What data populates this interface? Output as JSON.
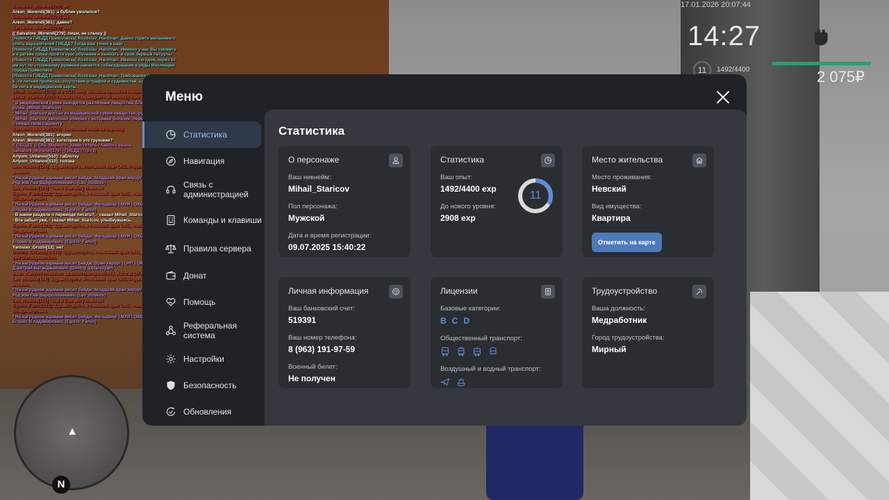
{
  "chat": [
    {
      "t": "Salvatore_Morendi[279]: м?",
      "c": "red"
    },
    {
      "t": "Areon_Morendi[381]: а бублик уволился?",
      "c": ""
    },
    {
      "t": "Salvatore_Morendi[279]: да",
      "c": "red"
    },
    {
      "t": "Areon_Morendi[381]: давно?",
      "c": ""
    },
    {
      "t": "Salvatore_Morendi[279]: нез",
      "c": "red"
    },
    {
      "t": "(( Salvatore_Morendi[279]: пиши, не слышу ))",
      "c": ""
    },
    {
      "t": "[Новости ГИБДД Приволжска] Rostislav_Hardman: Давно горите желанием п опять нарушителей ГИБДД? Тогда вам точно к нам!",
      "c": "cyan"
    },
    {
      "t": "[Новости ГИБДД Приволжска] Rostislav_Hardman: Именно у нас Вы сможете в к раткие сроки пройти курс обучения и выехать в свой первый патруль!",
      "c": "cyan"
    },
    {
      "t": "[Новости ГИБДД Приволжска] Rostislav_Hardman: Именно сегодня, через 10 ми нут по столичному времени начнется собеседование в ряды Инспекции города Приволжск.",
      "c": "cyan"
    },
    {
      "t": "[Новости ГИБДД Приволжска] Rostislav_Hardman: Требования к кандидатам: 5 -ти летняя прописка, отсутствие штрафов и судимостей, наличие военного би лета и медицинской карты.",
      "c": "cyan"
    },
    {
      "t": "Mihail_Staricov[370]: Я в ОСП хочу. Можешь провести лекции, которые нужн",
      "c": "red"
    },
    {
      "t": "Mihail_Staricov[370]: Пожалуйста, ожидайте. Я выпишу Вам заключение.",
      "c": "red"
    },
    {
      "t": "* В медицинской сумке находятся различные лекарства, бланки эпикризов и ручка. (Mihail_Staricov)",
      "c": "violet"
    },
    {
      "t": "* Mihail_Staricov достал из медицинской сумки лекарство, ручку и эпикриз",
      "c": "violet"
    },
    {
      "t": "* Mihail_Staricov заполнил эпикриз с историей болезни, передал его вместе с лекарством пациенту",
      "c": "violet"
    },
    {
      "t": "Salvatore_Morendi[279]: заявление пиши на перевод",
      "c": "red"
    },
    {
      "t": "Areon_Morendi[381]: егорио",
      "c": ""
    },
    {
      "t": "Areon_Morendi[381]: категории b это грузовик?",
      "c": ""
    },
    {
      "t": "(( ОБЩЕЕ )) ОКБ Мирного: Заместитель главного врача Salvatore_Morendi[279] - ГИБДД (Тгр.г3)",
      "c": "pink"
    },
    {
      "t": "Artyom_Urbanov[510]: таблотку",
      "c": ""
    },
    {
      "t": "Artyom_Urbanov[510]: голова",
      "c": ""
    },
    {
      "t": "Lev_Rodkov[124]: Здравствуйте, я печаный врач ОКБ, Родков Лев Варфоло меевич.",
      "c": "red"
    },
    {
      "t": "* На нагрудном кармане висит бейдж: Младший врач-хирург | АХО | ОКБ-М | Род ков Лев Варфоломеевич. (Lev_Rodkov)",
      "c": "violet"
    },
    {
      "t": "Lev_Rodkov[124]: Чем я Вам могу помочь?",
      "c": "red"
    },
    {
      "t": "Egorio_Famin[322]: Здравствуйте, я печаный врач ОКБ, Фамин Егорио Владими рович.",
      "c": "red"
    },
    {
      "t": "* На нагрудном кармане висит бейдж: Фельдшер | МУИ | ОКБ-М | Фамин Егорио В ладимирович. (Egorio_Famin)",
      "c": "violet"
    },
    {
      "t": "- В каком разделе о переводе писать?, - сказал Mihail_Staricov, улыбнувши",
      "c": ""
    },
    {
      "t": "- Все забыл уже, - сказал Mihail_Staricov, улыбнувшись.",
      "c": ""
    },
    {
      "t": "Egorio_Famin[322]: Здравствуйте, я печаный врач ОКБ, Фамин Егорио Владими рович.",
      "c": "red"
    },
    {
      "t": "* На нагрудном кармане висит бейдж: Фельдшер | МУИ | ОКБ-М | Фамин Егорио В ладимирович. (Egorio_Famin)",
      "c": "violet"
    },
    {
      "t": "Yaroslav_Gruzin[12]: нет",
      "c": ""
    },
    {
      "t": "Dmitriy_Delarozyan[43]: Здравствуйте, я печаный врач ОКБ, Деларозян Дмит рий Ватанджанович.",
      "c": "red"
    },
    {
      "t": "* На нагрудном кармане висит бейдж: Врач-хирург | ОНТ | ОКБ-М | Деларозян Д митрий Ватанджанович. (Dmitriy_Delarozyan)",
      "c": "violet"
    },
    {
      "t": "Sean_Kadyrov повысил администратора Mirella_Kutaraz (АГА 30+ до МК)",
      "c": "red"
    },
    {
      "t": "Lev_Rodkov[124]: Здравствуйте, я печаный врач ОКБ, Родков Лев Варфоло меевич.",
      "c": "red"
    },
    {
      "t": "* На нагрудном кармане висит бейдж: Младший врач-хирург | АХО | ОКБ-М | Род ков Лев Варфоломеевич. (Lev_Rodkov)",
      "c": "violet"
    },
    {
      "t": "Lev_Rodkov[124]: Чем я Вам могу помочь?",
      "c": "red"
    },
    {
      "t": "Egorio_Famin[322]: Здравствуйте, я печаный врач ОКБ, Фамин Егорио Владими рович.",
      "c": "red"
    },
    {
      "t": "* На нагрудном кармане висит бейдж: Фельдшер | МУИ | ОКБ-М | Фамин Егорио В ладимирович. (Egorio_Famin)",
      "c": "violet"
    }
  ],
  "hud": {
    "date": "17.01.2026 20:07:44",
    "time": "14:27",
    "level": "11",
    "exp": "1492/4400",
    "money": "2 075₽"
  },
  "menu": {
    "title": "Меню",
    "close_icon": "close-icon",
    "nav": [
      {
        "label": "Статистика",
        "icon": "pie-chart-icon",
        "active": true
      },
      {
        "label": "Навигация",
        "icon": "compass-icon"
      },
      {
        "label": "Связь с администрацией",
        "icon": "headset-icon"
      },
      {
        "label": "Команды и клавиши",
        "icon": "keyboard-icon"
      },
      {
        "label": "Правила сервера",
        "icon": "scales-icon"
      },
      {
        "label": "Донат",
        "icon": "wallet-icon"
      },
      {
        "label": "Помощь",
        "icon": "heart-hand-icon"
      },
      {
        "label": "Реферальная система",
        "icon": "network-icon"
      },
      {
        "label": "Настройки",
        "icon": "gear-icon"
      },
      {
        "label": "Безопасность",
        "icon": "shield-icon"
      },
      {
        "label": "Обновления",
        "icon": "refresh-check-icon"
      }
    ],
    "content_title": "Статистика",
    "cards": {
      "persona": {
        "title": "О персонаже",
        "nickname_label": "Ваш никнейм:",
        "nickname": "Mihail_Staricov",
        "gender_label": "Пол персонажа:",
        "gender": "Мужской",
        "reg_label": "Дата и время регистрации:",
        "reg": "09.07.2025 15:40:22"
      },
      "stats": {
        "title": "Статистика",
        "exp_label": "Ваш опыт:",
        "exp": "1492/4400 exp",
        "next_label": "До нового уровня:",
        "next": "2908 exp",
        "level": "11",
        "progress": 0.339
      },
      "residence": {
        "title": "Место жительства",
        "place_label": "Место проживания:",
        "place": "Невский",
        "property_label": "Вид имущества:",
        "property": "Квартира",
        "map_button": "Отметить на карте"
      },
      "personal": {
        "title": "Личная информация",
        "bank_label": "Ваш банковский счет:",
        "bank": "519391",
        "phone_label": "Ваш номер телефона:",
        "phone": "8 (963) 191-97-59",
        "military_label": "Военный билет:",
        "military": "Не получен"
      },
      "licenses": {
        "title": "Лицензии",
        "base_label": "Базовые категории:",
        "categories": [
          "B",
          "C",
          "D"
        ],
        "public_label": "Общественный транспорт:",
        "air_label": "Воздушный и водный транспорт:"
      },
      "job": {
        "title": "Трудоустройство",
        "position_label": "Ваша должность:",
        "position": "Медработник",
        "city_label": "Город трудоустройства:",
        "city": "Мирный"
      }
    }
  },
  "colors": {
    "accent": "#5d8fd9",
    "panel": "#1f2227",
    "content": "#35383e",
    "card": "#2a2d32"
  }
}
